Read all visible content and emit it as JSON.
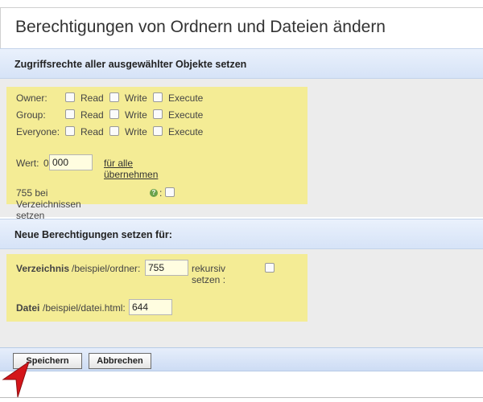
{
  "page": {
    "title": "Berechtigungen von Ordnern und Dateien ändern"
  },
  "access_section": {
    "heading": "Zugriffsrechte aller ausgewählter Objekte setzen",
    "rows": [
      {
        "label": "Owner:",
        "read": "Read",
        "write": "Write",
        "execute": "Execute"
      },
      {
        "label": "Group:",
        "read": "Read",
        "write": "Write",
        "execute": "Execute"
      },
      {
        "label": "Everyone:",
        "read": "Read",
        "write": "Write",
        "execute": "Execute"
      }
    ],
    "value_label": "Wert:",
    "value_prefix": "0",
    "value": "000",
    "apply_all_link": "für alle übernehmen",
    "dir_755_label": "755 bei Verzeichnissen setzen",
    "dir_755_suffix": ":"
  },
  "new_perms_section": {
    "heading": "Neue Berechtigungen setzen für:",
    "folder_label": "Verzeichnis",
    "folder_path": "/beispiel/ordner:",
    "folder_value": "755",
    "recursive_label": "rekursiv setzen :",
    "file_label": "Datei",
    "file_path": "/beispiel/datei.html:",
    "file_value": "644"
  },
  "buttons": {
    "save": "Speichern",
    "cancel": "Abbrechen"
  },
  "colors": {
    "highlight": "#f4ec95",
    "header_blue": "#d6e3f7",
    "panel_gray": "#ececec",
    "cursor_red": "#d4151a"
  }
}
